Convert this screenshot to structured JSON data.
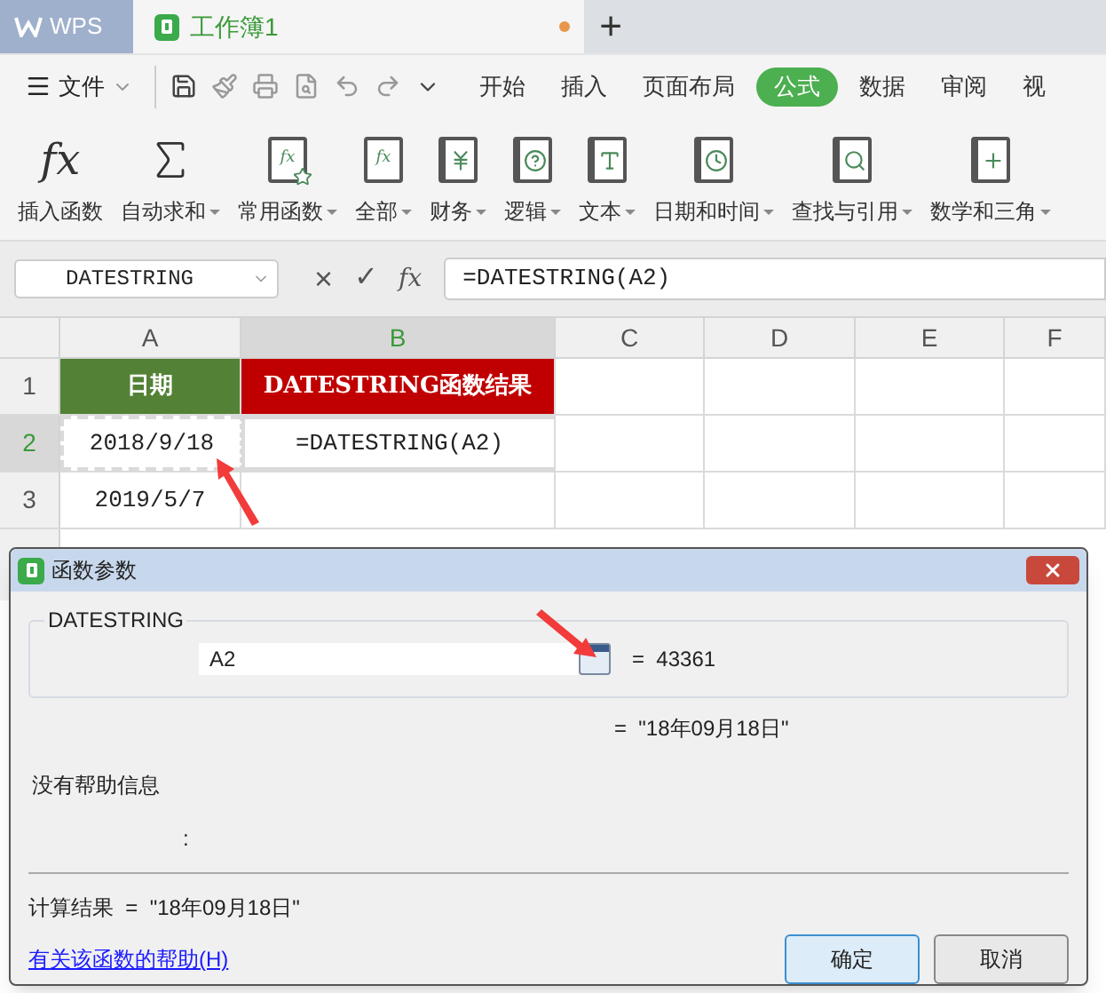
{
  "app_tab": {
    "label": "WPS"
  },
  "document_tab": {
    "label": "工作簿1",
    "unsaved": true
  },
  "new_tab": {
    "label": "+"
  },
  "file_menu": {
    "label": "文件"
  },
  "ribbon_tabs": [
    {
      "label": "开始",
      "selected": false
    },
    {
      "label": "插入",
      "selected": false
    },
    {
      "label": "页面布局",
      "selected": false
    },
    {
      "label": "公式",
      "selected": true
    },
    {
      "label": "数据",
      "selected": false
    },
    {
      "label": "审阅",
      "selected": false
    },
    {
      "label": "视",
      "selected": false
    }
  ],
  "tools": [
    {
      "kind": "insert",
      "glyph": "fx",
      "label": "插入函数",
      "dropdown": false
    },
    {
      "kind": "sum",
      "label": "自动求和",
      "dropdown": true
    },
    {
      "kind": "common",
      "glyph": "fx",
      "label": "常用函数",
      "dropdown": true
    },
    {
      "kind": "all",
      "glyph": "fx",
      "label": "全部",
      "dropdown": true
    },
    {
      "kind": "finance",
      "label": "财务",
      "dropdown": true
    },
    {
      "kind": "logic",
      "label": "逻辑",
      "dropdown": true
    },
    {
      "kind": "text",
      "label": "文本",
      "dropdown": true
    },
    {
      "kind": "datetime",
      "label": "日期和时间",
      "dropdown": true
    },
    {
      "kind": "lookup",
      "label": "查找与引用",
      "dropdown": true
    },
    {
      "kind": "math",
      "label": "数学和三角",
      "dropdown": true
    }
  ],
  "name_box": "DATESTRING",
  "formula_bar": {
    "cancel": "×",
    "enter": "✓",
    "fx": "fx",
    "value": "=DATESTRING(A2)"
  },
  "columns": [
    {
      "label": "A",
      "selected": false
    },
    {
      "label": "B",
      "selected": true
    },
    {
      "label": "C",
      "selected": false
    },
    {
      "label": "D",
      "selected": false
    },
    {
      "label": "E",
      "selected": false
    },
    {
      "label": "F",
      "selected": false
    }
  ],
  "rows": [
    {
      "number": "1",
      "selected": false,
      "cells": [
        {
          "kind": "header",
          "text": "日期",
          "color": "#538135"
        },
        {
          "kind": "header",
          "text": "DATESTRING函数结果",
          "color": "#c00000"
        }
      ]
    },
    {
      "number": "2",
      "selected": true,
      "cells": [
        {
          "kind": "copy-source",
          "text": "2018/9/18"
        },
        {
          "kind": "active",
          "text": "=DATESTRING(A2)"
        }
      ]
    },
    {
      "number": "3",
      "selected": false,
      "cells": [
        {
          "kind": "plain",
          "text": "2019/5/7"
        }
      ]
    }
  ],
  "dialog": {
    "title": "函数参数",
    "function_name": "DATESTRING",
    "argument": "A2",
    "argument_value": "=  43361",
    "preview": "=  \"18年09月18日\"",
    "description": "没有帮助信息",
    "parameter_description": ":",
    "result": "计算结果  =  \"18年09月18日\"",
    "help_link": "有关该函数的帮助(H)",
    "buttons": [
      {
        "label": "确定",
        "default": true
      },
      {
        "label": "取消",
        "default": false
      }
    ]
  }
}
